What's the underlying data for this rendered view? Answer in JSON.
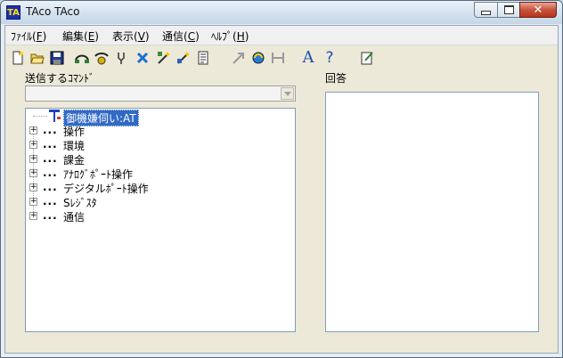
{
  "window": {
    "title": "TAco TAco",
    "icon_label": "TA",
    "controls": {
      "minimize": "minimize-icon",
      "maximize": "maximize-icon",
      "close": "close-icon"
    }
  },
  "menu": [
    {
      "label": "ﾌｧｲﾙ(F)",
      "underline": "F"
    },
    {
      "label": "編集(E)",
      "underline": "E"
    },
    {
      "label": "表示(V)",
      "underline": "V"
    },
    {
      "label": "通信(C)",
      "underline": "C"
    },
    {
      "label": "ﾍﾙﾌﾟ(H)",
      "underline": "H"
    }
  ],
  "toolbar": {
    "buttons": [
      "new-file-icon",
      "open-folder-icon",
      "save-icon",
      "connect-icon",
      "dial-icon",
      "tool-icon",
      "delete-icon",
      "wand-icon",
      "edit-wand-icon",
      "document-icon",
      "arrow-icon",
      "refresh-icon",
      "tools-icon",
      "font-icon",
      "help-icon",
      "notepad-icon"
    ],
    "font_glyph": "A",
    "help_glyph": "?"
  },
  "command": {
    "label": "送信するｺﾏﾝﾄﾞ",
    "value": ""
  },
  "response": {
    "label": "回答"
  },
  "tree": {
    "root": "御機嫌伺い:AT",
    "items": [
      "操作",
      "環境",
      "課金",
      "ｱﾅﾛｸﾞﾎﾟｰﾄ操作",
      "デジタルﾎﾟｰﾄ操作",
      "Sﾚｼﾞｽﾀ",
      "通信"
    ],
    "expander": "+",
    "ellipsis": "..."
  },
  "colors": {
    "selection": "#316ac5",
    "titlebar": "#d4e2ef",
    "close": "#c7543c"
  }
}
